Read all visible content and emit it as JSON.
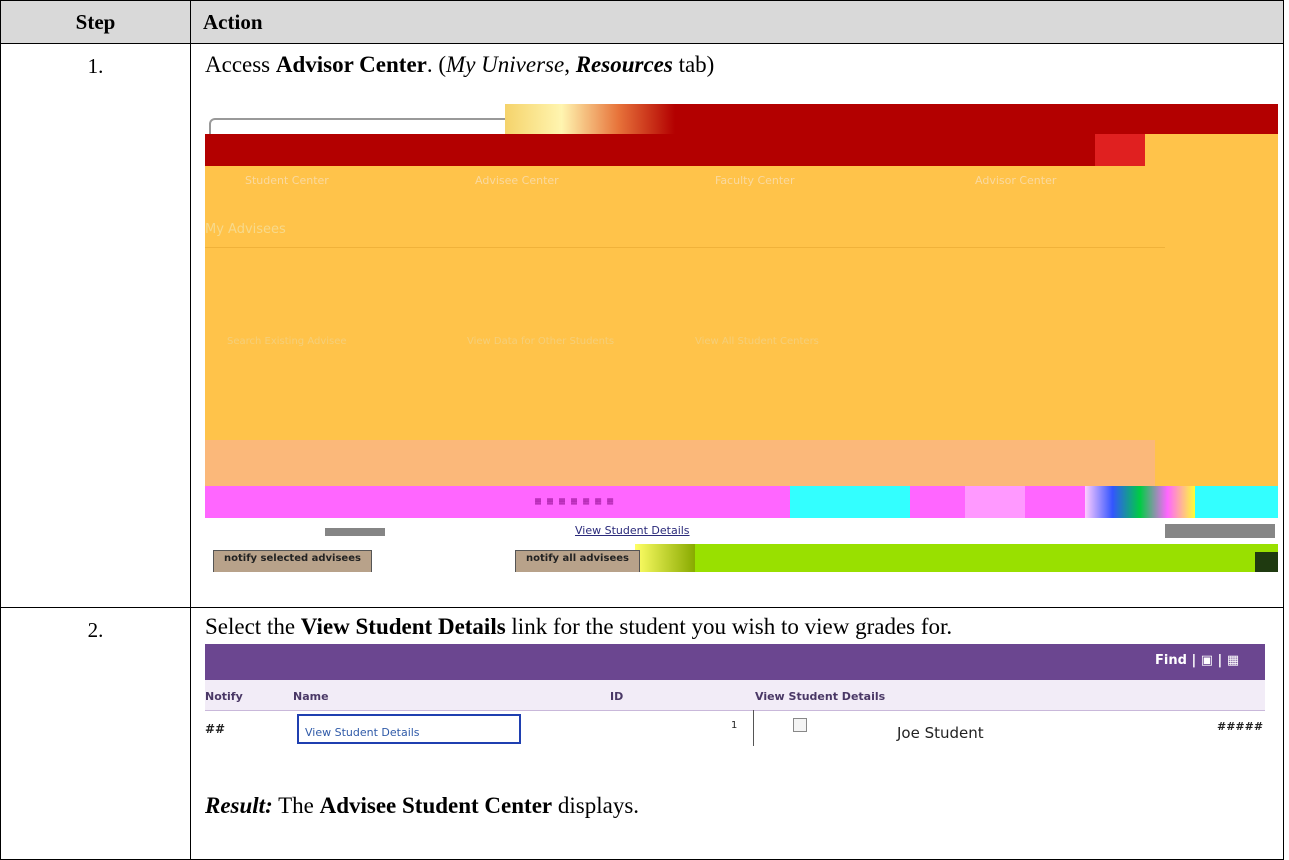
{
  "headers": {
    "step": "Step",
    "action": "Action"
  },
  "rows": [
    {
      "num": "1.",
      "text": {
        "pre": "Access ",
        "bold": "Advisor Center",
        "mid": ".  (",
        "ital1": "My Universe",
        "comma": ", ",
        "bi": "Resources",
        "post": " tab)"
      },
      "screenshot": {
        "tabs": [
          "Student Center",
          "Advisee Center",
          "Faculty Center",
          "Advisor Center"
        ],
        "section": "My Advisees",
        "links": [
          "Search Existing Advisee",
          "View Data for Other Students",
          "View All Student Centers"
        ],
        "row_link": "View Student Details",
        "buttons": [
          "notify selected advisees",
          "notify all advisees"
        ],
        "colors": {
          "banner": "#b30000",
          "body": "#ffc34a",
          "magenta": "#ff66ff",
          "cyan": "#33ffff",
          "green": "#99e000"
        }
      }
    },
    {
      "num": "2.",
      "text": {
        "pre": "Select the ",
        "bold": "View Student Details",
        "post": " link for the student you wish to view grades for."
      },
      "screenshot": {
        "find": "Find",
        "columns": [
          "Notify",
          "Name",
          "ID",
          "View Student Details"
        ],
        "row": {
          "hash": "##",
          "link": "View Student Details",
          "seq": "1",
          "name": "Joe Student",
          "id": "#####"
        },
        "colors": {
          "bar": "#6b4690",
          "header_row": "#f2ecf7",
          "link_border": "#1f3fb0"
        }
      },
      "result": {
        "label": "Result:",
        "pre": "  The ",
        "bold": "Advisee Student Center",
        "post": " displays."
      }
    }
  ]
}
